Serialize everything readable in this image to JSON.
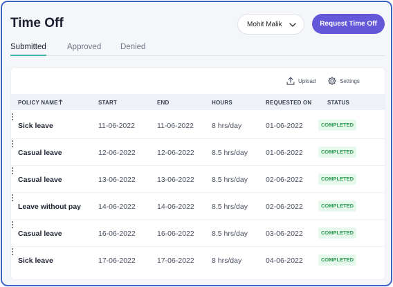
{
  "header": {
    "title": "Time Off",
    "user_select": "Mohit Malik",
    "request_button": "Request Time Off"
  },
  "tabs": [
    {
      "label": "Submitted",
      "active": true
    },
    {
      "label": "Approved",
      "active": false
    },
    {
      "label": "Denied",
      "active": false
    }
  ],
  "toolbar": {
    "upload_label": "Upload",
    "settings_label": "Settings"
  },
  "table": {
    "columns": {
      "policy": "POLICY NAME",
      "start": "START",
      "end": "END",
      "hours": "HOURS",
      "requested": "REQUESTED ON",
      "status": "STATUS"
    },
    "rows": [
      {
        "policy": "Sick leave",
        "start": "11-06-2022",
        "end": "11-06-2022",
        "hours": "8 hrs/day",
        "requested": "01-06-2022",
        "status": "COMPLETED"
      },
      {
        "policy": "Casual leave",
        "start": "12-06-2022",
        "end": "12-06-2022",
        "hours": "8.5 hrs/day",
        "requested": "01-06-2022",
        "status": "COMPLETED"
      },
      {
        "policy": "Casual leave",
        "start": "13-06-2022",
        "end": "13-06-2022",
        "hours": "8.5 hrs/day",
        "requested": "02-06-2022",
        "status": "COMPLETED"
      },
      {
        "policy": "Leave without pay",
        "start": "14-06-2022",
        "end": "14-06-2022",
        "hours": "8.5 hrs/day",
        "requested": "02-06-2022",
        "status": "COMPLETED"
      },
      {
        "policy": "Casual leave",
        "start": "16-06-2022",
        "end": "16-06-2022",
        "hours": "8.5 hrs/day",
        "requested": "03-06-2022",
        "status": "COMPLETED"
      },
      {
        "policy": "Sick leave",
        "start": "17-06-2022",
        "end": "17-06-2022",
        "hours": "8 hrs/day",
        "requested": "04-06-2022",
        "status": "COMPLETED"
      }
    ]
  },
  "colors": {
    "accent": "#6457d8",
    "tab_indicator": "#3fb6a5",
    "status_bg": "#e6f7ec",
    "status_text": "#2e9e54",
    "frame_border": "#3d63c4"
  },
  "icons": {
    "user_select": "chevron-down-icon",
    "upload": "upload-icon",
    "settings": "gear-icon",
    "sort": "sort-up-arrow-icon",
    "row_menu": "kebab-menu-icon"
  }
}
